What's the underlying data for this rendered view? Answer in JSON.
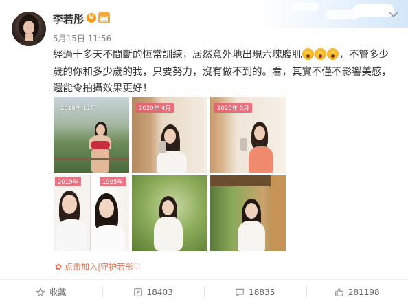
{
  "post": {
    "username": "李若彤",
    "verified_badge": "V",
    "timestamp": "5月15日 11:56",
    "text_part1": "經過十多天不間斷的恆常訓練，居然意外地出現六塊腹肌",
    "text_part2": "，不管多少歲的你和多少歲的我，只要努力，沒有做不到的。看，其實不僅不影響美感，還能令拍攝效果更好！",
    "emoji_count": 3
  },
  "photos": [
    {
      "tag": "2019年 11月"
    },
    {
      "tag": "2020年 4月"
    },
    {
      "tag": "2020年 5月"
    },
    {
      "tag_left": "2019年",
      "tag_right": "1995年"
    },
    {},
    {}
  ],
  "supertopic": {
    "label": "点击加入|守护若彤♡"
  },
  "actions": {
    "favorite": "收藏",
    "repost_count": "18403",
    "comment_count": "18835",
    "like_count": "281198"
  },
  "colors": {
    "accent": "#eb7350",
    "verified": "#f89c1c",
    "tag_bg": "#e85a6e"
  },
  "icons": [
    "chevron-down-icon",
    "crown-icon",
    "emoji-icon",
    "flower-icon",
    "star-icon",
    "repost-icon",
    "comment-icon",
    "like-icon"
  ]
}
